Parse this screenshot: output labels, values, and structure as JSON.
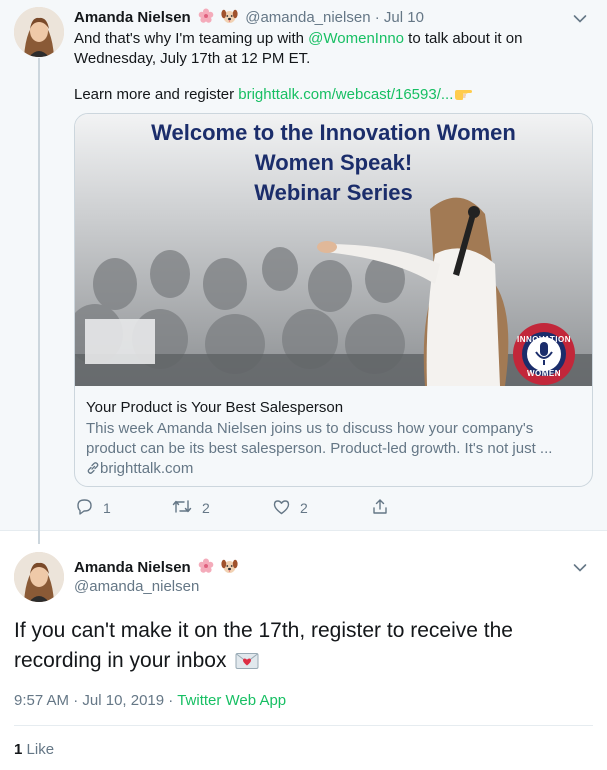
{
  "first_tweet": {
    "author_name": "Amanda Nielsen",
    "handle": "@amanda_nielsen",
    "separator": "·",
    "date": "Jul 10",
    "text_before_mention": "And that's why I'm teaming up with ",
    "mention": "@WomenInno",
    "text_after_mention": " to talk about it on Wednesday, July 17th at 12 PM ET.",
    "learn_text": "Learn more and register ",
    "learn_link": "brighttalk.com/webcast/16593/...",
    "card": {
      "banner_line_1": "Welcome to the Innovation Women",
      "banner_line_2": "Women Speak!",
      "banner_line_3": "Webinar Series",
      "badge_top": "INNOVATION",
      "badge_bottom": "WOMEN",
      "title": "Your Product is Your Best Salesperson",
      "description": "This week Amanda Nielsen joins us to discuss how your company's product can be its best salesperson. Product-led growth. It's not just ...",
      "domain": "brighttalk.com"
    },
    "actions": {
      "reply_count": "1",
      "retweet_count": "2",
      "like_count": "2"
    }
  },
  "second_tweet": {
    "author_name": "Amanda Nielsen",
    "handle": "@amanda_nielsen",
    "text": "If you can't make it on the 17th, register to receive the recording in your inbox",
    "time": "9:57 AM",
    "date": "Jul 10, 2019",
    "separator": "·",
    "source": "Twitter Web App",
    "like_count": "1",
    "like_label": "Like"
  },
  "colors": {
    "link_blue": "#1da1f2",
    "link_green": "#17bf63",
    "muted_gray": "#657786",
    "banner_navy": "#1b2d6b"
  },
  "icons": [
    "cherry-blossom-emoji",
    "dog-emoji",
    "pointing-hand-emoji",
    "love-letter-emoji",
    "chevron-down-icon",
    "reply-icon",
    "retweet-icon",
    "heart-icon",
    "share-icon",
    "link-icon"
  ]
}
